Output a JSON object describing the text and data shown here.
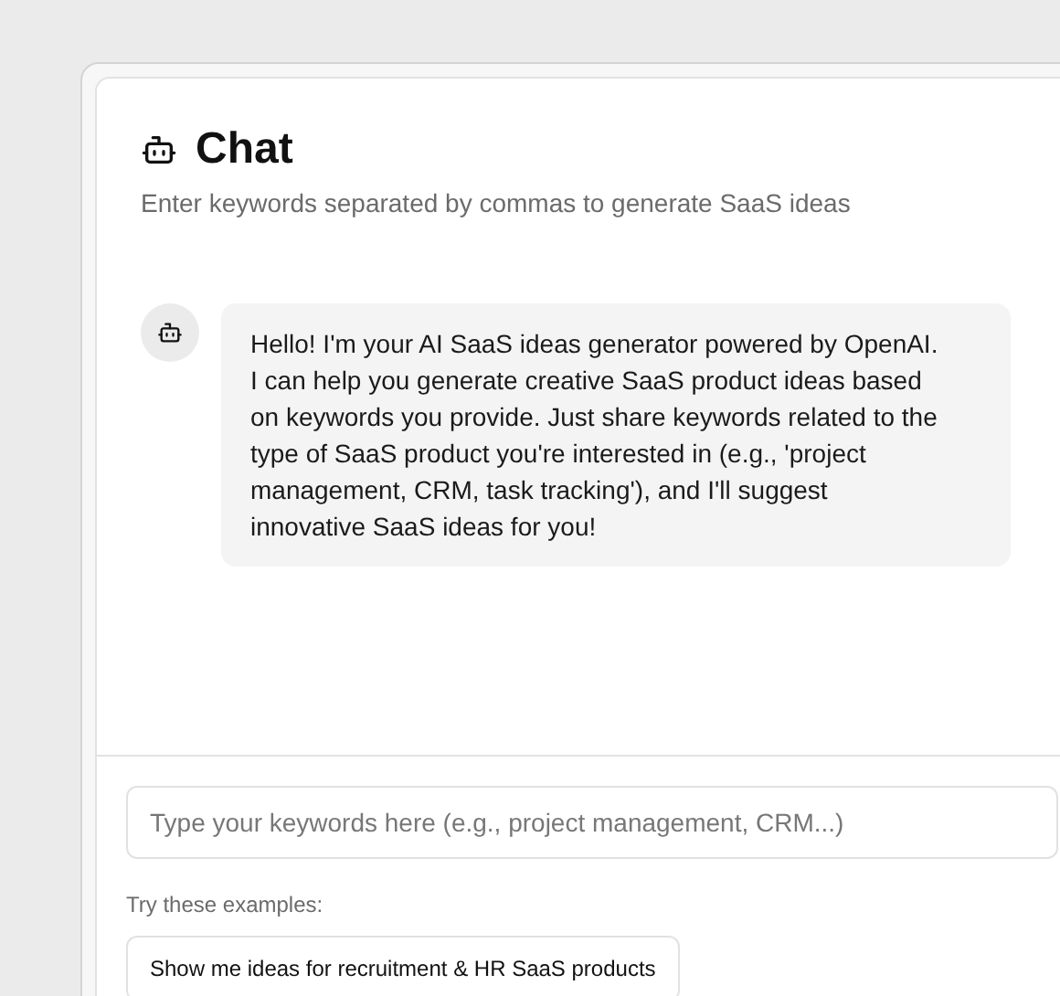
{
  "header": {
    "title": "Chat",
    "subtitle": "Enter keywords separated by commas to generate SaaS ideas"
  },
  "messages": [
    {
      "kind": "assistant",
      "text": "Hello! I'm your AI SaaS ideas generator powered by OpenAI. I can help you generate creative SaaS product ideas based on keywords you provide. Just share keywords related to the type of SaaS product you're interested in (e.g., 'project management, CRM, task tracking'), and I'll suggest innovative SaaS ideas for you!"
    }
  ],
  "input": {
    "placeholder": "Type your keywords here (e.g., project management, CRM...)"
  },
  "examples": {
    "label": "Try these examples:",
    "items": [
      "Show me ideas for recruitment & HR SaaS products"
    ]
  }
}
